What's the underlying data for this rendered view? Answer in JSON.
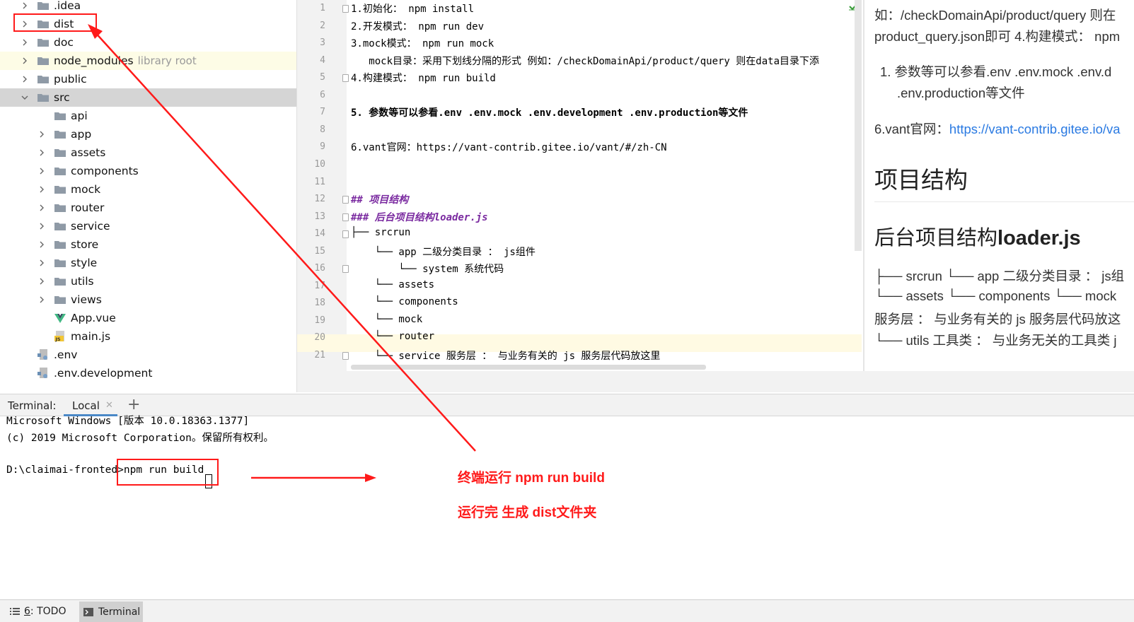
{
  "tree": {
    "items": [
      {
        "label": ".idea",
        "type": "folder",
        "chevron": true,
        "indent": 0,
        "icon": "folder-icon"
      },
      {
        "label": "dist",
        "type": "folder",
        "chevron": true,
        "indent": 0,
        "icon": "folder-icon"
      },
      {
        "label": "doc",
        "type": "folder",
        "chevron": true,
        "indent": 0,
        "icon": "folder-icon"
      },
      {
        "label": "node_modules",
        "type": "folder",
        "chevron": true,
        "indent": 0,
        "icon": "folder-icon",
        "suffix": "library root",
        "highlight": "library"
      },
      {
        "label": "public",
        "type": "folder",
        "chevron": true,
        "indent": 0,
        "icon": "folder-icon"
      },
      {
        "label": "src",
        "type": "folder",
        "chevron": "open",
        "indent": 0,
        "icon": "folder-icon",
        "highlight": "selected"
      },
      {
        "label": "api",
        "type": "folder",
        "chevron": false,
        "indent": 1,
        "icon": "folder-icon"
      },
      {
        "label": "app",
        "type": "folder",
        "chevron": true,
        "indent": 1,
        "icon": "folder-icon"
      },
      {
        "label": "assets",
        "type": "folder",
        "chevron": true,
        "indent": 1,
        "icon": "folder-icon"
      },
      {
        "label": "components",
        "type": "folder",
        "chevron": true,
        "indent": 1,
        "icon": "folder-icon"
      },
      {
        "label": "mock",
        "type": "folder",
        "chevron": true,
        "indent": 1,
        "icon": "folder-icon"
      },
      {
        "label": "router",
        "type": "folder",
        "chevron": true,
        "indent": 1,
        "icon": "folder-icon"
      },
      {
        "label": "service",
        "type": "folder",
        "chevron": true,
        "indent": 1,
        "icon": "folder-icon"
      },
      {
        "label": "store",
        "type": "folder",
        "chevron": true,
        "indent": 1,
        "icon": "folder-icon"
      },
      {
        "label": "style",
        "type": "folder",
        "chevron": true,
        "indent": 1,
        "icon": "folder-icon"
      },
      {
        "label": "utils",
        "type": "folder",
        "chevron": true,
        "indent": 1,
        "icon": "folder-icon"
      },
      {
        "label": "views",
        "type": "folder",
        "chevron": true,
        "indent": 1,
        "icon": "folder-icon"
      },
      {
        "label": "App.vue",
        "type": "file",
        "chevron": false,
        "indent": 1,
        "icon": "vue-file-icon"
      },
      {
        "label": "main.js",
        "type": "file",
        "chevron": false,
        "indent": 1,
        "icon": "js-file-icon"
      },
      {
        "label": ".env",
        "type": "file",
        "chevron": false,
        "indent": 0,
        "icon": "env-file-icon"
      },
      {
        "label": ".env.development",
        "type": "file",
        "chevron": false,
        "indent": 0,
        "icon": "env-file-icon"
      }
    ]
  },
  "editor": {
    "current_line": 20,
    "lines": [
      {
        "n": "1",
        "text": "1.初始化： npm install",
        "style": ""
      },
      {
        "n": "2",
        "text": "2.开发模式： npm run dev",
        "style": ""
      },
      {
        "n": "3",
        "text": "3.mock模式： npm run mock",
        "style": ""
      },
      {
        "n": "4",
        "text": "   mock目录：采用下划线分隔的形式 例如：/checkDomainApi/product/query 则在data目录下添",
        "style": ""
      },
      {
        "n": "5",
        "text": "4.构建模式： npm run build",
        "style": ""
      },
      {
        "n": "6",
        "text": "",
        "style": ""
      },
      {
        "n": "7",
        "text": "5. 参数等可以参看.env .env.mock .env.development .env.production等文件",
        "style": "b"
      },
      {
        "n": "8",
        "text": "",
        "style": ""
      },
      {
        "n": "9",
        "text": "6.vant官网：https://vant-contrib.gitee.io/vant/#/zh-CN",
        "style": ""
      },
      {
        "n": "10",
        "text": "",
        "style": ""
      },
      {
        "n": "11",
        "text": "",
        "style": ""
      },
      {
        "n": "12",
        "text": "## 项目结构",
        "style": "h"
      },
      {
        "n": "13",
        "text": "### 后台项目结构loader.js",
        "style": "h"
      },
      {
        "n": "14",
        "text": "├── srcrun",
        "style": ""
      },
      {
        "n": "15",
        "text": "    └── app 二级分类目录 ： js组件",
        "style": ""
      },
      {
        "n": "16",
        "text": "        └── system 系统代码",
        "style": ""
      },
      {
        "n": "17",
        "text": "    └── assets",
        "style": ""
      },
      {
        "n": "18",
        "text": "    └── components",
        "style": ""
      },
      {
        "n": "19",
        "text": "    └── mock",
        "style": ""
      },
      {
        "n": "20",
        "text": "    └── router",
        "style": ""
      },
      {
        "n": "21",
        "text": "    └── service 服务层 ： 与业务有关的 js 服务层代码放这里",
        "style": ""
      }
    ]
  },
  "preview": {
    "line1": "如：/checkDomainApi/product/query 则在",
    "line2": "product_query.json即可 4.构建模式： npm",
    "item1_a": "1.  参数等可以参看.env .env.mock .env.d",
    "item1_b": ".env.production等文件",
    "vant_prefix": "6.vant官网：",
    "vant_link": "https://vant-contrib.gitee.io/va",
    "h2": "项目结构",
    "h3_prefix": "后台项目结构",
    "h3_bold": "loader.js",
    "tree1": "├── srcrun └── app 二级分类目录 ： js组",
    "tree2": "└── assets └── components └── mock",
    "tree3": "服务层 ： 与业务有关的 js 服务层代码放这",
    "tree4": "└── utils 工具类 ： 与业务无关的工具类 j"
  },
  "terminal": {
    "label": "Terminal:",
    "tab": "Local",
    "lines": [
      "Microsoft Windows [版本 10.0.18363.1377]",
      "(c) 2019 Microsoft Corporation。保留所有权利。",
      "",
      "D:\\claimai-fronted>npm run build"
    ]
  },
  "statusbar": {
    "todo_num": "6",
    "todo_label": ": TODO",
    "terminal": "Terminal"
  },
  "annotations": {
    "note1": "终端运行 npm run build",
    "note2": "运行完 生成 dist文件夹",
    "color": "#ff1a1a"
  },
  "colors": {
    "folder": "#8f9aa6",
    "selected_row": "#d5d5d5",
    "library_row": "#fdfce6",
    "current_line": "#fffae3",
    "heading": "#7a2aa0",
    "link": "#2a7ae2",
    "accent": "#4a88c7"
  }
}
